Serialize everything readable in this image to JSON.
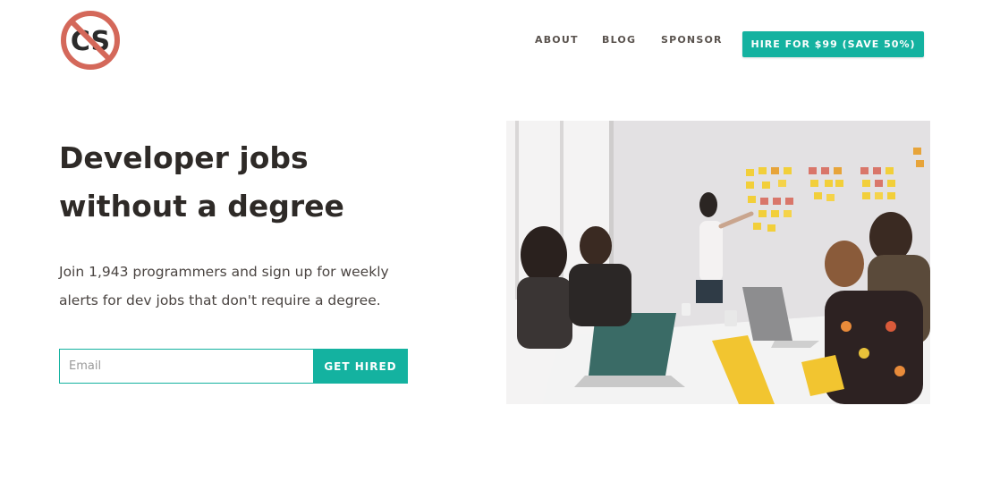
{
  "header": {
    "logo_text": "CS",
    "nav": [
      {
        "label": "ABOUT"
      },
      {
        "label": "BLOG"
      },
      {
        "label": "SPONSOR"
      }
    ],
    "hire_button": "HIRE FOR $99 (SAVE 50%)"
  },
  "hero": {
    "headline_line1": "Developer jobs",
    "headline_line2": "without a degree",
    "sub_line1": "Join 1,943 programmers and sign up for weekly",
    "sub_line2": "alerts for dev jobs that don't require a degree."
  },
  "signup": {
    "email_placeholder": "Email",
    "submit_label": "GET HIRED"
  },
  "colors": {
    "accent": "#14b2a0",
    "logo_ring": "#d4685a",
    "text": "#2e2a27"
  },
  "photo": {
    "icon": "team-meeting-photo"
  }
}
